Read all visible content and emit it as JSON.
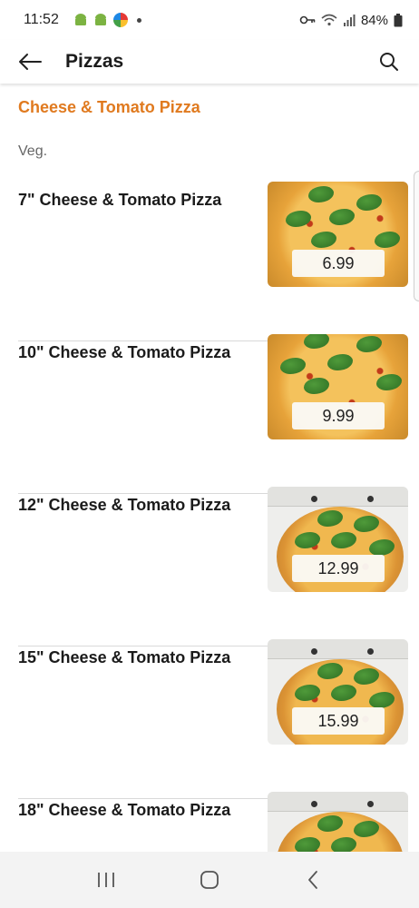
{
  "status_bar": {
    "time": "11:52",
    "battery": "84%",
    "icons": [
      "android-icon",
      "android-icon",
      "app-icon",
      "dot-icon",
      "vpn-key-icon",
      "wifi-icon",
      "signal-icon",
      "battery-icon"
    ]
  },
  "app_bar": {
    "title": "Pizzas",
    "back_icon": "arrow-left-icon",
    "search_icon": "search-icon"
  },
  "section": {
    "title": "Cheese & Tomato Pizza",
    "category": "Veg."
  },
  "items": [
    {
      "name": "7\" Cheese & Tomato Pizza",
      "price": "6.99",
      "image": "pizza-plain"
    },
    {
      "name": "10\" Cheese & Tomato Pizza",
      "price": "9.99",
      "image": "pizza-plain"
    },
    {
      "name": "12\" Cheese & Tomato Pizza",
      "price": "12.99",
      "image": "pizza-box"
    },
    {
      "name": "15\" Cheese & Tomato Pizza",
      "price": "15.99",
      "image": "pizza-box"
    },
    {
      "name": "18\" Cheese & Tomato Pizza",
      "price": "",
      "image": "pizza-box"
    }
  ],
  "nav_bar": {
    "icons": [
      "recents-icon",
      "home-icon",
      "back-icon"
    ]
  },
  "colors": {
    "accent": "#e07a1f",
    "text": "#1b1b1b",
    "divider": "#d9d9d9"
  }
}
